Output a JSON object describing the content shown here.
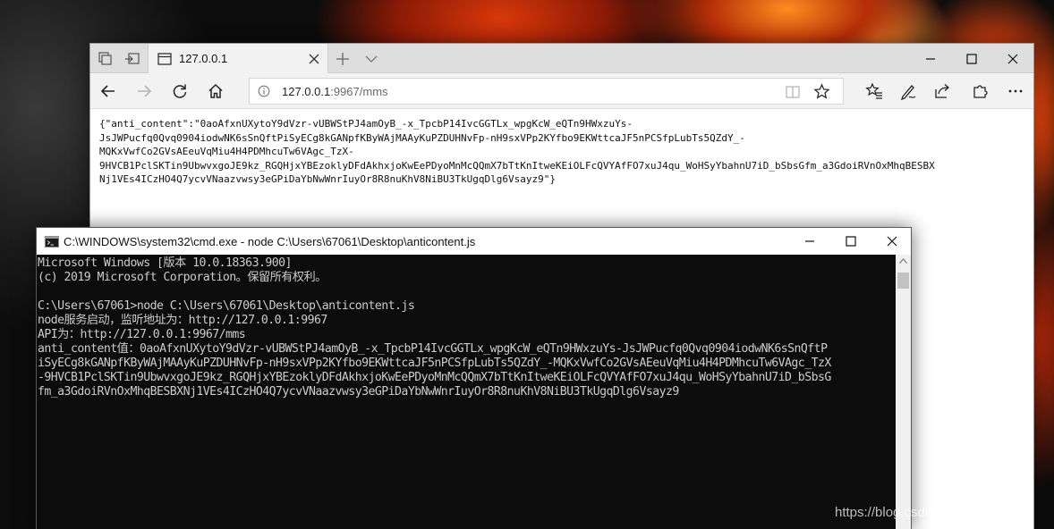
{
  "browser": {
    "tab_title": "127.0.0.1",
    "url_host": "127.0.0.1",
    "url_rest": ":9967/mms",
    "page_text": "{\"anti_content\":\"0aoAfxnUXytoY9dVzr-vUBWStPJ4amOyB_-x_TpcbP14IvcGGTLx_wpgKcW_eQTn9HWxzuYs-JsJWPucfq0Qvq0904iodwNK6sSnQftPiSyECg8kGANpfKByWAjMAAyKuPZDUHNvFp-nH9sxVPp2KYfbo9EKWttcaJF5nPCSfpLubTs5QZdY_-MQKxVwfCo2GVsAEeuVqMiu4H4PDMhcuTw6VAgc_TzX-9HVCB1PclSKTin9UbwvxgoJE9kz_RGQHjxYBEzoklyDFdAkhxjoKwEePDyoMnMcQQmX7bTtKnItweKEiOLFcQVYAfFO7xuJ4qu_WoHSyYbahnU7iD_bSbsGfm_a3GdoiRVnOxMhqBESBXNj1VEs4ICzHO4Q7ycvVNaazvwsy3eGPiDaYbNwWnrIuyOr8R8nuKhV8NiBU3TkUgqDlg6Vsayz9\"}",
    "page_lines": [
      "{\"anti_content\":\"0aoAfxnUXytoY9dVzr-vUBWStPJ4amOyB_-x_TpcbP14IvcGGTLx_wpgKcW_eQTn9HWxzuYs-",
      "JsJWPucfq0Qvq0904iodwNK6sSnQftPiSyECg8kGANpfKByWAjMAAyKuPZDUHNvFp-nH9sxVPp2KYfbo9EKWttcaJF5nPCSfpLubTs5QZdY_-",
      "MQKxVwfCo2GVsAEeuVqMiu4H4PDMhcuTw6VAgc_TzX-",
      "9HVCB1PclSKTin9UbwvxgoJE9kz_RGQHjxYBEzoklyDFdAkhxjoKwEePDyoMnMcQQmX7bTtKnItweKEiOLFcQVYAfFO7xuJ4qu_WoHSyYbahnU7iD_bSbsGfm_a3GdoiRVnOxMhqBESBX",
      "Nj1VEs4ICzHO4Q7ycvVNaazvwsy3eGPiDaYbNwWnrIuyOr8R8nuKhV8NiBU3TkUgqDlg6Vsayz9\"}"
    ]
  },
  "cmd": {
    "title": "C:\\WINDOWS\\system32\\cmd.exe - node  C:\\Users\\67061\\Desktop\\anticontent.js",
    "lines": [
      "Microsoft Windows [版本 10.0.18363.900]",
      "(c) 2019 Microsoft Corporation。保留所有权利。",
      "",
      "C:\\Users\\67061>node C:\\Users\\67061\\Desktop\\anticontent.js",
      "node服务启动，监听地址为：http://127.0.0.1:9967",
      "API为：http://127.0.0.1:9967/mms",
      "anti_content值：0aoAfxnUXytoY9dVzr-vUBWStPJ4amOyB_-x_TpcbP14IvcGGTLx_wpgKcW_eQTn9HWxzuYs-JsJWPucfq0Qvq0904iodwNK6sSnQftP",
      "iSyECg8kGANpfKByWAjMAAyKuPZDUHNvFp-nH9sxVPp2KYfbo9EKWttcaJF5nPCSfpLubTs5QZdY_-MQKxVwfCo2GVsAEeuVqMiu4H4PDMhcuTw6VAgc_TzX",
      "-9HVCB1PclSKTin9UbwvxgoJE9kz_RGQHjxYBEzoklyDFdAkhxjoKwEePDyoMnMcQQmX7bTtKnItweKEiOLFcQVYAfFO7xuJ4qu_WoHSyYbahnU7iD_bSbsG",
      "fm_a3GdoiRVnOxMhqBESBXNj1VEs4ICzHO4Q7ycvVNaazvwsy3eGPiDaYbNwWnrIuyOr8R8nuKhV8NiBU3TkUgqDlg6Vsayz9"
    ]
  },
  "watermark": "https://blog.csdn.net/Tomorrow_a",
  "icons": {
    "tab_list": "tab-list-icon",
    "set_aside": "set-aside-tabs-icon",
    "page": "page-icon",
    "close_tab": "close-tab-icon",
    "new_tab": "new-tab-icon",
    "tab_preview": "chevron-down-icon",
    "back": "back-arrow-icon",
    "forward": "forward-arrow-icon",
    "refresh": "refresh-icon",
    "home": "home-icon",
    "info": "info-icon",
    "reading_view": "reading-view-icon",
    "favorite": "star-icon",
    "favorites": "favorites-icon",
    "notes": "pen-icon",
    "share": "share-icon",
    "extensions": "extensions-icon",
    "more": "more-icon",
    "cmd": "cmd-icon"
  },
  "colors": {
    "console_bg": "#0c0c0c",
    "console_text": "#cccccc",
    "browser_chrome": "#f2f2f2"
  }
}
